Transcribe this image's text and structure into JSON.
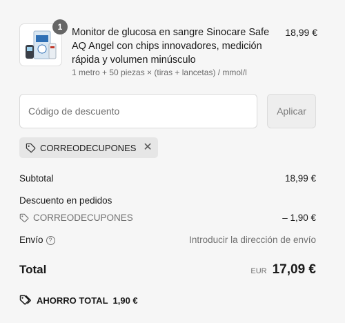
{
  "product": {
    "quantity": "1",
    "title": "Monitor de glucosa en sangre Sinocare Safe AQ Angel con chips innovadores, medición rápida y volumen minúsculo",
    "variant": "1 metro + 50 piezas × (tiras + lancetas) / mmol/l",
    "price": "18,99 €"
  },
  "discount": {
    "placeholder": "Código de descuento",
    "apply_label": "Aplicar",
    "applied_code": "CORREODECUPONES"
  },
  "summary": {
    "subtotal_label": "Subtotal",
    "subtotal_value": "18,99 €",
    "order_discount_label": "Descuento en pedidos",
    "order_discount_code": "CORREODECUPONES",
    "order_discount_value": "– 1,90 €",
    "shipping_label": "Envío",
    "shipping_value": "Introducir la dirección de envío",
    "total_label": "Total",
    "total_currency": "EUR",
    "total_value": "17,09 €",
    "savings_label": "AHORRO TOTAL",
    "savings_value": "1,90 €"
  },
  "icons": {
    "tag": "tag-icon",
    "close": "close-icon",
    "help": "help-icon",
    "tags": "tags-icon"
  }
}
